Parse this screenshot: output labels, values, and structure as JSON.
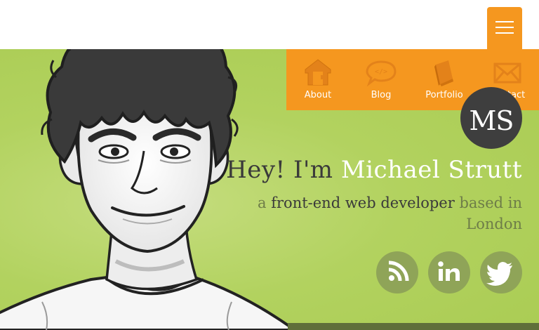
{
  "header": {
    "menu_icon": "hamburger-icon",
    "accent_color": "#f5971f"
  },
  "nav": [
    {
      "label": "About",
      "icon": "house-icon"
    },
    {
      "label": "Blog",
      "icon": "code-speech-bubble-icon"
    },
    {
      "label": "Portfolio",
      "icon": "book-icon"
    },
    {
      "label": "Contact",
      "icon": "envelope-icon"
    }
  ],
  "hero": {
    "monogram": "MS",
    "greeting": "Hey! I'm",
    "name": "Michael Strutt",
    "sub_prefix": "a",
    "sub_role": "front-end web developer",
    "sub_suffix": "based in London",
    "background_color": "#b2d25f",
    "illustration": "cartoon-portrait-illustration"
  },
  "social": [
    {
      "name": "rss",
      "icon": "rss-icon"
    },
    {
      "name": "linkedin",
      "icon": "linkedin-icon"
    },
    {
      "name": "twitter",
      "icon": "twitter-bird-icon"
    }
  ]
}
